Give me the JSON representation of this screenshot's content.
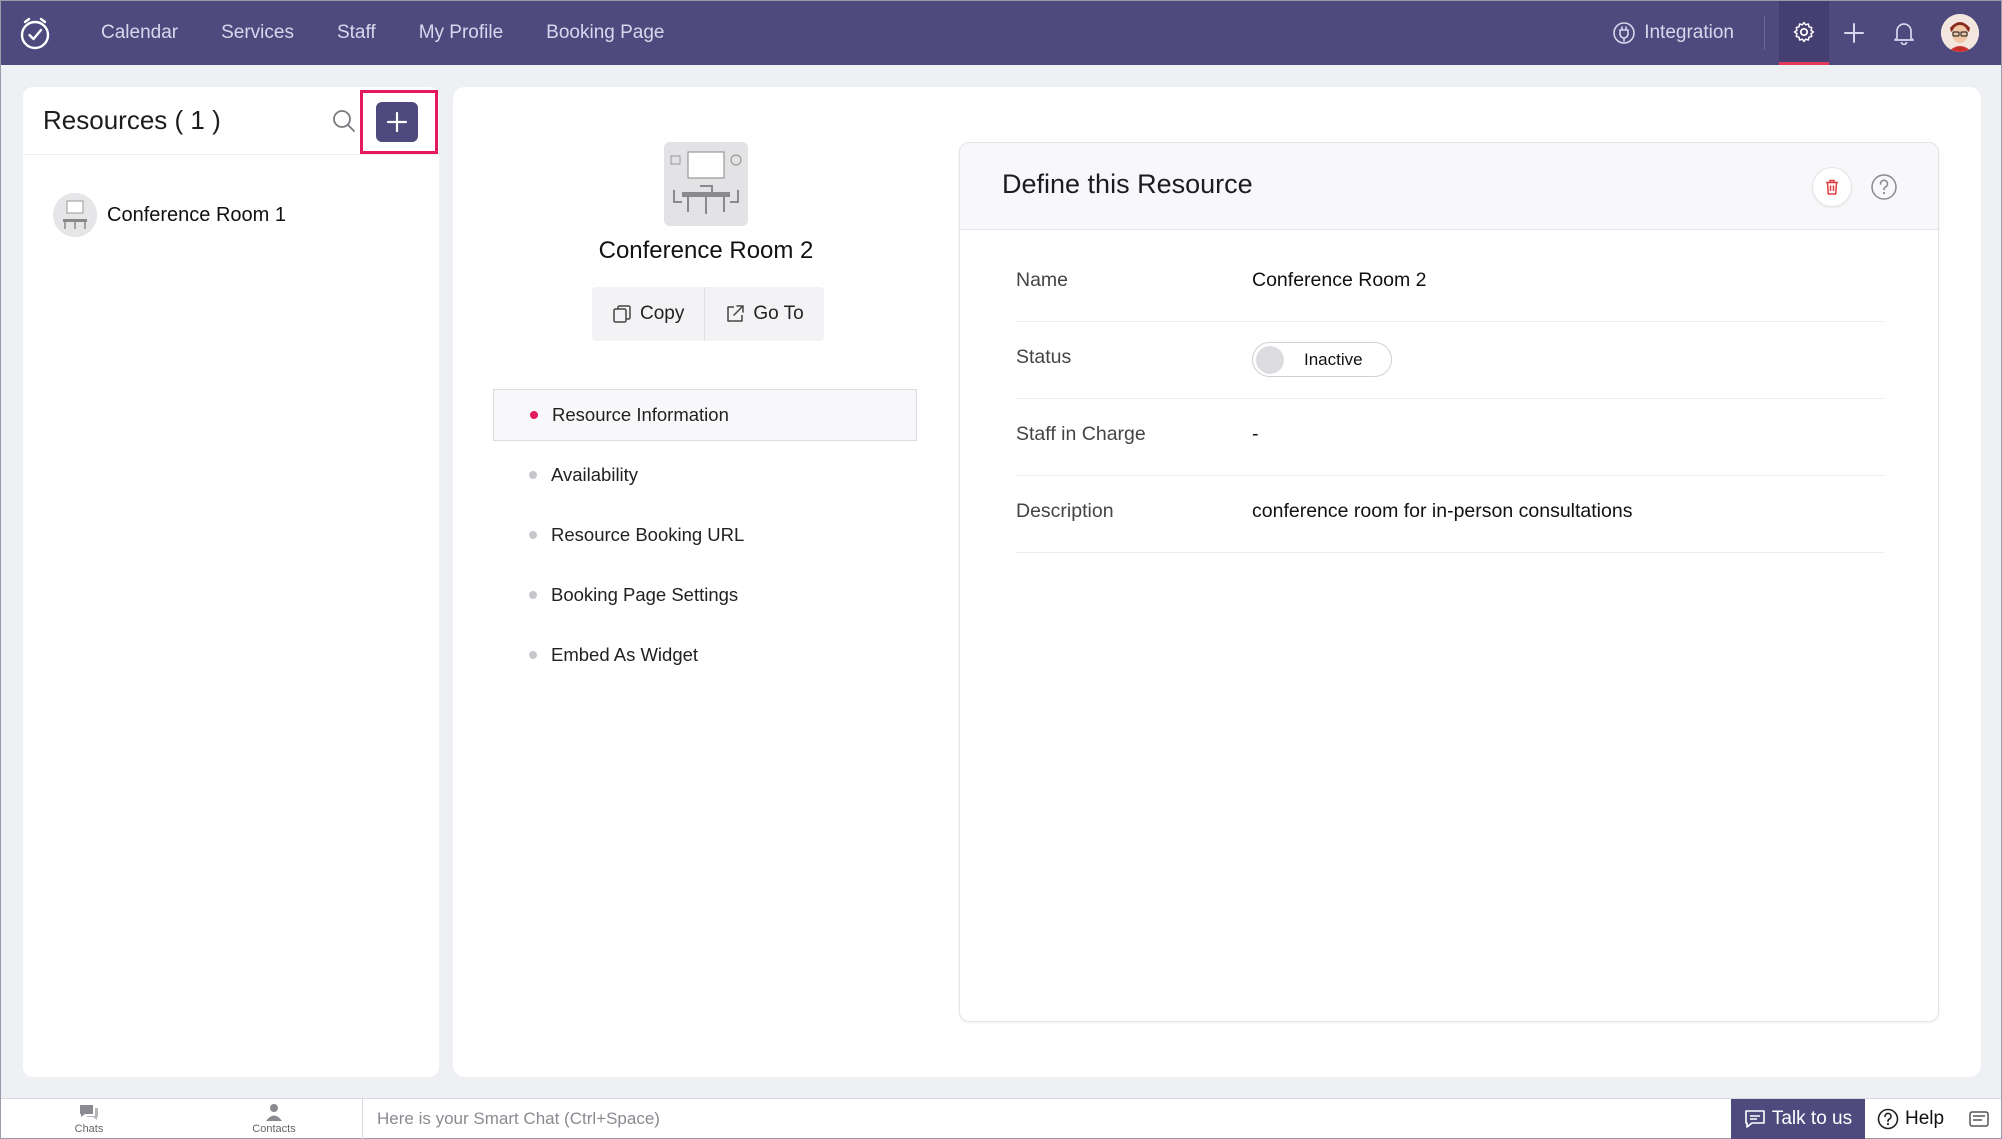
{
  "nav": {
    "links": [
      "Calendar",
      "Services",
      "Staff",
      "My Profile",
      "Booking Page"
    ],
    "integration_label": "Integration"
  },
  "resources": {
    "title": "Resources ( 1 )",
    "items": [
      {
        "name": "Conference Room 1"
      }
    ]
  },
  "detail": {
    "name": "Conference Room 2",
    "copy_label": "Copy",
    "goto_label": "Go To",
    "menu": [
      {
        "label": "Resource Information",
        "active": true
      },
      {
        "label": "Availability",
        "active": false
      },
      {
        "label": "Resource Booking URL",
        "active": false
      },
      {
        "label": "Booking Page Settings",
        "active": false
      },
      {
        "label": "Embed As Widget",
        "active": false
      }
    ]
  },
  "define": {
    "title": "Define this Resource",
    "fields": {
      "name_label": "Name",
      "name_value": "Conference Room 2",
      "status_label": "Status",
      "status_value": "Inactive",
      "staff_label": "Staff in Charge",
      "staff_value": "-",
      "description_label": "Description",
      "description_value": "conference room for in-person consultations"
    }
  },
  "bottom": {
    "chats_label": "Chats",
    "contacts_label": "Contacts",
    "smart_chat_placeholder": "Here is your Smart Chat (Ctrl+Space)",
    "talk_label": "Talk to us",
    "help_label": "Help"
  },
  "colors": {
    "nav_bg": "#4f4a7e",
    "accent": "#e5195d",
    "panel_bg": "#ffffff",
    "page_bg": "#eef0f4"
  }
}
